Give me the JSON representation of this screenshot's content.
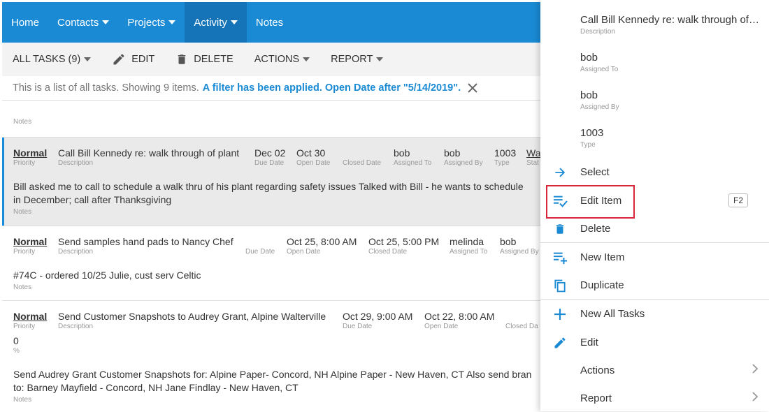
{
  "nav": {
    "home": "Home",
    "contacts": "Contacts",
    "projects": "Projects",
    "activity": "Activity",
    "notes": "Notes"
  },
  "toolbar": {
    "all_tasks": "ALL TASKS (9)",
    "edit": "EDIT",
    "delete": "DELETE",
    "actions": "ACTIONS",
    "report": "REPORT"
  },
  "filter": {
    "info": "This is a list of all tasks. Showing 9 items.",
    "applied": "A filter has been applied. Open Date after \"5/14/2019\"."
  },
  "list_header": {
    "notes_label": "Notes"
  },
  "rows": [
    {
      "priority": "Normal",
      "priority_label": "Priority",
      "description": "Call Bill Kennedy re: walk through of plant",
      "description_label": "Description",
      "due_date": "Dec 02",
      "due_date_label": "Due Date",
      "open_date": "Oct 30",
      "open_date_label": "Open Date",
      "closed_date_label": "Closed Date",
      "assigned_to": "bob",
      "assigned_to_label": "Assigned To",
      "assigned_by": "bob",
      "assigned_by_label": "Assigned By",
      "type": "1003",
      "type_label": "Type",
      "status": "Wa",
      "status_label": "Stat",
      "notes_line1": "Bill asked me to call to schedule a walk thru of his plant regarding safety issues Talked with Bill - he wants to schedule",
      "notes_line2": "in December; call after Thanksgiving",
      "notes_label": "Notes"
    },
    {
      "priority": "Normal",
      "priority_label": "Priority",
      "description": "Send samples hand pads to Nancy Chef",
      "description_label": "Description",
      "due_date_label": "Due Date",
      "open_date": "Oct 25, 8:00 AM",
      "open_date_label": "Open Date",
      "closed_date": "Oct 25, 5:00 PM",
      "closed_date_label": "Closed Date",
      "assigned_to": "melinda",
      "assigned_to_label": "Assigned To",
      "assigned_by": "bob",
      "assigned_by_label": "Assigned By",
      "notes_line1": "#74C - ordered 10/25 Julie, cust serv Celtic",
      "notes_label": "Notes"
    },
    {
      "priority": "Normal",
      "priority_label": "Priority",
      "description": "Send Customer Snapshots to Audrey Grant, Alpine Walterville",
      "description_label": "Description",
      "due_date": "Oct 29, 9:00 AM",
      "due_date_label": "Due Date",
      "open_date": "Oct 22, 8:00 AM",
      "open_date_label": "Open Date",
      "closed_date_label": "Closed Da",
      "percent": "0",
      "percent_label": "%",
      "notes_line1": "Send Audrey Grant Customer Snapshots for: Alpine Paper- Concord, NH Alpine Paper - New Haven, CT Also send bran",
      "notes_line2": "to: Barney Mayfield - Concord, NH Jane Findlay - New Haven, CT",
      "notes_label": "Notes"
    }
  ],
  "context_panel": {
    "fields": [
      {
        "value": "Call Bill Kennedy re: walk through of pl...",
        "label": "Description"
      },
      {
        "value": "bob",
        "label": "Assigned To"
      },
      {
        "value": "bob",
        "label": "Assigned By"
      },
      {
        "value": "1003",
        "label": "Type"
      }
    ],
    "menu": {
      "select": "Select",
      "edit_item": "Edit Item",
      "edit_item_shortcut": "F2",
      "delete": "Delete",
      "new_item": "New Item",
      "duplicate": "Duplicate",
      "new_all_tasks": "New All Tasks",
      "edit": "Edit",
      "actions": "Actions",
      "report": "Report"
    }
  },
  "colors": {
    "accent": "#1a8ad4",
    "highlight": "#d9263a"
  }
}
